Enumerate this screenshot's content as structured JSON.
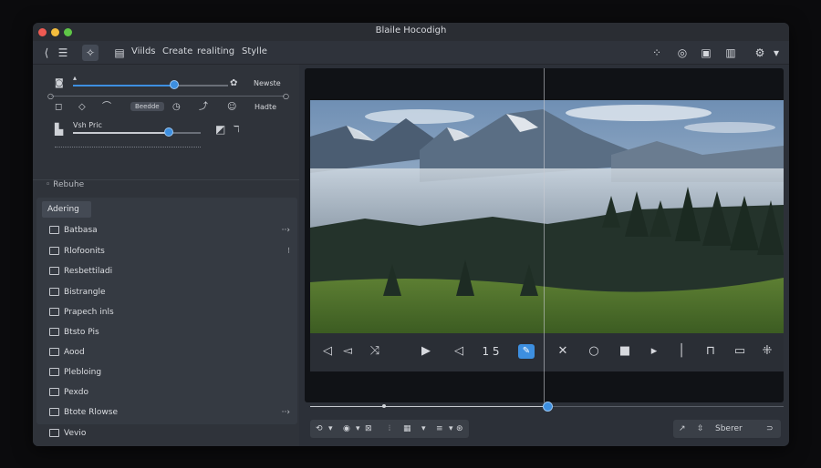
{
  "window": {
    "title": "Blaile Hocodigh"
  },
  "toolbar": {
    "tabs": [
      {
        "label": "Viilds"
      },
      {
        "label": "Create"
      },
      {
        "label": "realiting"
      },
      {
        "label": "Stylle"
      }
    ],
    "icons": [
      "back-arrow-icon",
      "menu-icon",
      "sparkle-icon",
      "doc-icon",
      "grid-icon",
      "circle-icon",
      "image-icon",
      "list-icon",
      "gear-icon",
      "chevron-down-icon"
    ]
  },
  "controls": {
    "row1_right_label": "Newste",
    "row2_pill": "Beedde",
    "row2_right_label": "Hadte",
    "slider2_label": "Vsh Pric",
    "slider1_fraction": 0.65,
    "slider2_fraction": 0.75
  },
  "sidebar": {
    "section_label": "Rebuhe",
    "list_header": "Adering",
    "items": [
      {
        "label": "Batbasa",
        "more": "··›"
      },
      {
        "label": "Rlofoonits",
        "more": "⁝"
      },
      {
        "label": "Resbettiladi",
        "more": ""
      },
      {
        "label": "Bistrangle",
        "more": ""
      },
      {
        "label": "Prapech inls",
        "more": ""
      },
      {
        "label": "Btsto Pis",
        "more": ""
      },
      {
        "label": "Aood",
        "more": ""
      },
      {
        "label": "Plebloing",
        "more": ""
      },
      {
        "label": "Pexdo",
        "more": ""
      },
      {
        "label": "Btote Rlowse",
        "more": "··›"
      },
      {
        "label": "Vevio",
        "more": ""
      }
    ]
  },
  "player": {
    "counter": "1 5",
    "scrub_fraction": 0.5
  },
  "bottom_right": {
    "label": "Sberer"
  },
  "colors": {
    "accent": "#3d8fe0",
    "window_bg": "#2c3038",
    "viewer_bg": "#101216"
  }
}
